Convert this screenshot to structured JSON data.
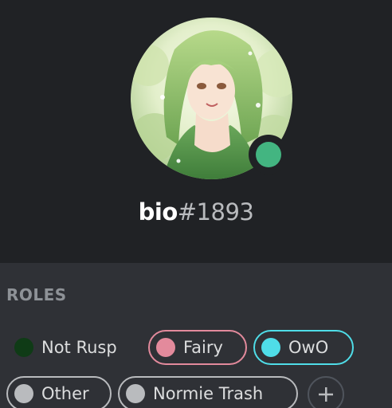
{
  "user": {
    "username": "bio",
    "discriminator": "#1893",
    "status_color": "#43b581"
  },
  "roles": {
    "title": "ROLES",
    "items": [
      {
        "name": "Not Rusp",
        "color": "#0f3b16"
      },
      {
        "name": "Fairy",
        "color": "#e38a9c"
      },
      {
        "name": "OwO",
        "color": "#4fdde8"
      },
      {
        "name": "Other",
        "color": "#b9bbbe"
      },
      {
        "name": "Normie Trash",
        "color": "#b9bbbe"
      }
    ],
    "add_icon": "plus-icon"
  }
}
